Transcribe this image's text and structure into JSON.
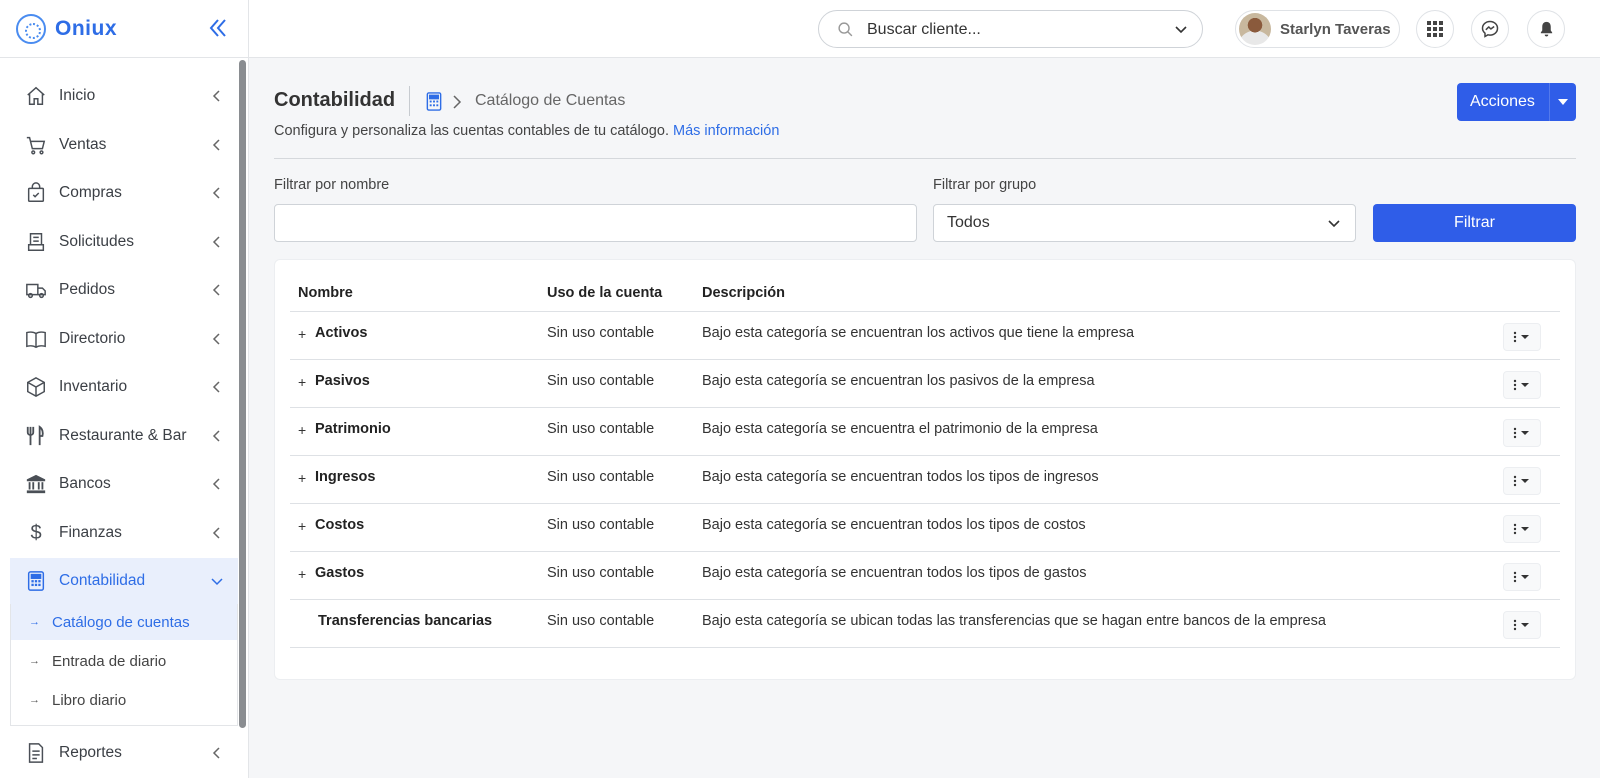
{
  "brand": {
    "name": "Oniux"
  },
  "colors": {
    "accent": "#2e6de6",
    "primary_button": "#2f5de8",
    "active_bg": "#e9effc"
  },
  "sidebar": {
    "items": [
      {
        "label": "Inicio",
        "icon": "home-icon"
      },
      {
        "label": "Ventas",
        "icon": "cart-icon"
      },
      {
        "label": "Compras",
        "icon": "shopping-bag-icon"
      },
      {
        "label": "Solicitudes",
        "icon": "receipt-icon"
      },
      {
        "label": "Pedidos",
        "icon": "truck-icon"
      },
      {
        "label": "Directorio",
        "icon": "book-icon"
      },
      {
        "label": "Inventario",
        "icon": "box-icon"
      },
      {
        "label": "Restaurante & Bar",
        "icon": "utensils-icon"
      },
      {
        "label": "Bancos",
        "icon": "bank-icon"
      },
      {
        "label": "Finanzas",
        "icon": "dollar-icon"
      },
      {
        "label": "Contabilidad",
        "icon": "calculator-icon",
        "active": true
      },
      {
        "label": "Reportes",
        "icon": "report-icon"
      }
    ],
    "subitems": [
      {
        "label": "Catálogo de cuentas",
        "active": true
      },
      {
        "label": "Entrada de diario"
      },
      {
        "label": "Libro diario"
      }
    ]
  },
  "topbar": {
    "search_placeholder": "Buscar cliente...",
    "user_name": "Starlyn Taveras"
  },
  "header": {
    "title": "Contabilidad",
    "breadcrumb": "Catálogo de Cuentas",
    "subtitle": "Configura y personaliza las cuentas contables de tu catálogo.",
    "more_info": "Más información",
    "actions_label": "Acciones"
  },
  "filters": {
    "name_label": "Filtrar por nombre",
    "name_value": "",
    "group_label": "Filtrar por grupo",
    "group_value": "Todos",
    "button": "Filtrar"
  },
  "table": {
    "columns": [
      "Nombre",
      "Uso de la cuenta",
      "Descripción"
    ],
    "rows": [
      {
        "expandable": "+",
        "name": "Activos",
        "uso": "Sin uso contable",
        "desc": "Bajo esta categoría se encuentran los activos que tiene la empresa"
      },
      {
        "expandable": "+",
        "name": "Pasivos",
        "uso": "Sin uso contable",
        "desc": "Bajo esta categoría se encuentran los pasivos de la empresa"
      },
      {
        "expandable": "+",
        "name": "Patrimonio",
        "uso": "Sin uso contable",
        "desc": "Bajo esta categoría se encuentra el patrimonio de la empresa"
      },
      {
        "expandable": "+",
        "name": "Ingresos",
        "uso": "Sin uso contable",
        "desc": "Bajo esta categoría se encuentran todos los tipos de ingresos"
      },
      {
        "expandable": "+",
        "name": "Costos",
        "uso": "Sin uso contable",
        "desc": "Bajo esta categoría se encuentran todos los tipos de costos"
      },
      {
        "expandable": "+",
        "name": "Gastos",
        "uso": "Sin uso contable",
        "desc": "Bajo esta categoría se encuentran todos los tipos de gastos"
      },
      {
        "expandable": "",
        "name": "Transferencias bancarias",
        "uso": "Sin uso contable",
        "desc": "Bajo esta categoría se ubican todas las transferencias que se hagan entre bancos de la empresa"
      }
    ]
  }
}
